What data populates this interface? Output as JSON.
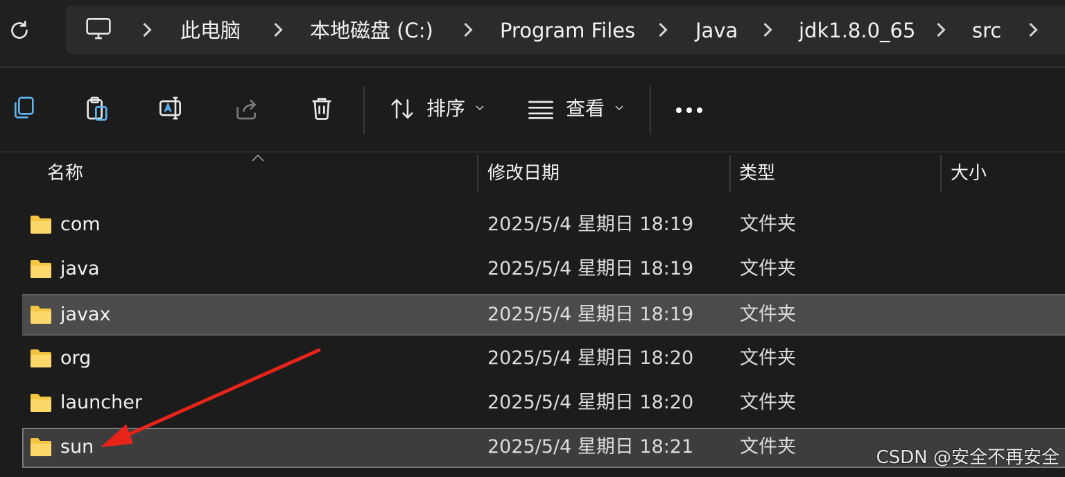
{
  "breadcrumb": [
    "此电脑",
    "本地磁盘 (C:)",
    "Program Files",
    "Java",
    "jdk1.8.0_65",
    "src"
  ],
  "toolbar": {
    "sort_label": "排序",
    "view_label": "查看",
    "icons": [
      "copy-icon",
      "paste-icon",
      "rename-icon",
      "share-icon",
      "delete-icon",
      "sort-icon",
      "view-icon",
      "more-icon"
    ]
  },
  "columns": {
    "name": "名称",
    "modified": "修改日期",
    "type": "类型",
    "size": "大小"
  },
  "files": [
    {
      "name": "com",
      "modified": "2025/5/4 星期日 18:19",
      "type": "文件夹"
    },
    {
      "name": "java",
      "modified": "2025/5/4 星期日 18:19",
      "type": "文件夹"
    },
    {
      "name": "javax",
      "modified": "2025/5/4 星期日 18:19",
      "type": "文件夹"
    },
    {
      "name": "org",
      "modified": "2025/5/4 星期日 18:20",
      "type": "文件夹"
    },
    {
      "name": "launcher",
      "modified": "2025/5/4 星期日 18:20",
      "type": "文件夹"
    },
    {
      "name": "sun",
      "modified": "2025/5/4 星期日 18:21",
      "type": "文件夹"
    }
  ],
  "watermark": "CSDN @安全不再安全",
  "colors": {
    "background": "#1c1c1c",
    "selected_row": "#4b4b4b",
    "folder": "#f5c542",
    "annotation_arrow": "#e8241a",
    "accent": "#5fb4f0"
  }
}
